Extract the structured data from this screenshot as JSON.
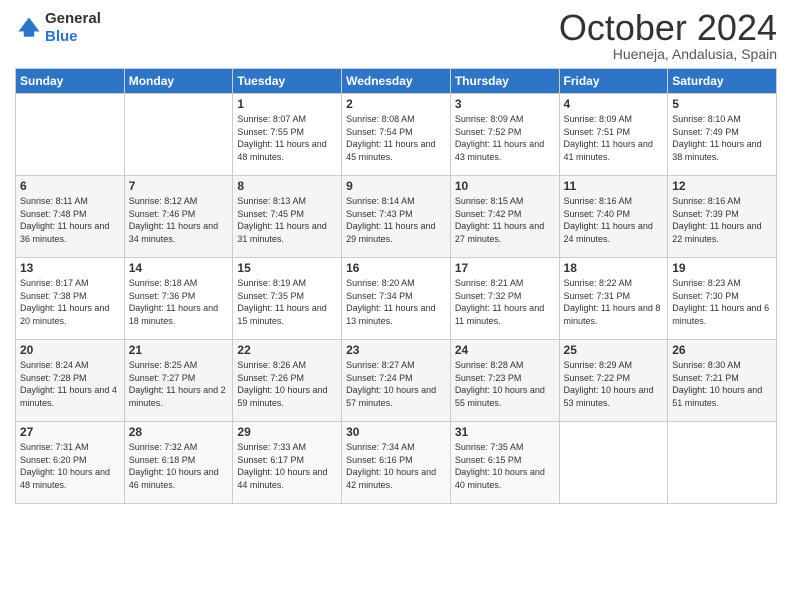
{
  "logo": {
    "general": "General",
    "blue": "Blue"
  },
  "header": {
    "month": "October 2024",
    "location": "Hueneja, Andalusia, Spain"
  },
  "days_of_week": [
    "Sunday",
    "Monday",
    "Tuesday",
    "Wednesday",
    "Thursday",
    "Friday",
    "Saturday"
  ],
  "weeks": [
    [
      {
        "day": "",
        "info": ""
      },
      {
        "day": "",
        "info": ""
      },
      {
        "day": "1",
        "info": "Sunrise: 8:07 AM\nSunset: 7:55 PM\nDaylight: 11 hours and 48 minutes."
      },
      {
        "day": "2",
        "info": "Sunrise: 8:08 AM\nSunset: 7:54 PM\nDaylight: 11 hours and 45 minutes."
      },
      {
        "day": "3",
        "info": "Sunrise: 8:09 AM\nSunset: 7:52 PM\nDaylight: 11 hours and 43 minutes."
      },
      {
        "day": "4",
        "info": "Sunrise: 8:09 AM\nSunset: 7:51 PM\nDaylight: 11 hours and 41 minutes."
      },
      {
        "day": "5",
        "info": "Sunrise: 8:10 AM\nSunset: 7:49 PM\nDaylight: 11 hours and 38 minutes."
      }
    ],
    [
      {
        "day": "6",
        "info": "Sunrise: 8:11 AM\nSunset: 7:48 PM\nDaylight: 11 hours and 36 minutes."
      },
      {
        "day": "7",
        "info": "Sunrise: 8:12 AM\nSunset: 7:46 PM\nDaylight: 11 hours and 34 minutes."
      },
      {
        "day": "8",
        "info": "Sunrise: 8:13 AM\nSunset: 7:45 PM\nDaylight: 11 hours and 31 minutes."
      },
      {
        "day": "9",
        "info": "Sunrise: 8:14 AM\nSunset: 7:43 PM\nDaylight: 11 hours and 29 minutes."
      },
      {
        "day": "10",
        "info": "Sunrise: 8:15 AM\nSunset: 7:42 PM\nDaylight: 11 hours and 27 minutes."
      },
      {
        "day": "11",
        "info": "Sunrise: 8:16 AM\nSunset: 7:40 PM\nDaylight: 11 hours and 24 minutes."
      },
      {
        "day": "12",
        "info": "Sunrise: 8:16 AM\nSunset: 7:39 PM\nDaylight: 11 hours and 22 minutes."
      }
    ],
    [
      {
        "day": "13",
        "info": "Sunrise: 8:17 AM\nSunset: 7:38 PM\nDaylight: 11 hours and 20 minutes."
      },
      {
        "day": "14",
        "info": "Sunrise: 8:18 AM\nSunset: 7:36 PM\nDaylight: 11 hours and 18 minutes."
      },
      {
        "day": "15",
        "info": "Sunrise: 8:19 AM\nSunset: 7:35 PM\nDaylight: 11 hours and 15 minutes."
      },
      {
        "day": "16",
        "info": "Sunrise: 8:20 AM\nSunset: 7:34 PM\nDaylight: 11 hours and 13 minutes."
      },
      {
        "day": "17",
        "info": "Sunrise: 8:21 AM\nSunset: 7:32 PM\nDaylight: 11 hours and 11 minutes."
      },
      {
        "day": "18",
        "info": "Sunrise: 8:22 AM\nSunset: 7:31 PM\nDaylight: 11 hours and 8 minutes."
      },
      {
        "day": "19",
        "info": "Sunrise: 8:23 AM\nSunset: 7:30 PM\nDaylight: 11 hours and 6 minutes."
      }
    ],
    [
      {
        "day": "20",
        "info": "Sunrise: 8:24 AM\nSunset: 7:28 PM\nDaylight: 11 hours and 4 minutes."
      },
      {
        "day": "21",
        "info": "Sunrise: 8:25 AM\nSunset: 7:27 PM\nDaylight: 11 hours and 2 minutes."
      },
      {
        "day": "22",
        "info": "Sunrise: 8:26 AM\nSunset: 7:26 PM\nDaylight: 10 hours and 59 minutes."
      },
      {
        "day": "23",
        "info": "Sunrise: 8:27 AM\nSunset: 7:24 PM\nDaylight: 10 hours and 57 minutes."
      },
      {
        "day": "24",
        "info": "Sunrise: 8:28 AM\nSunset: 7:23 PM\nDaylight: 10 hours and 55 minutes."
      },
      {
        "day": "25",
        "info": "Sunrise: 8:29 AM\nSunset: 7:22 PM\nDaylight: 10 hours and 53 minutes."
      },
      {
        "day": "26",
        "info": "Sunrise: 8:30 AM\nSunset: 7:21 PM\nDaylight: 10 hours and 51 minutes."
      }
    ],
    [
      {
        "day": "27",
        "info": "Sunrise: 7:31 AM\nSunset: 6:20 PM\nDaylight: 10 hours and 48 minutes."
      },
      {
        "day": "28",
        "info": "Sunrise: 7:32 AM\nSunset: 6:18 PM\nDaylight: 10 hours and 46 minutes."
      },
      {
        "day": "29",
        "info": "Sunrise: 7:33 AM\nSunset: 6:17 PM\nDaylight: 10 hours and 44 minutes."
      },
      {
        "day": "30",
        "info": "Sunrise: 7:34 AM\nSunset: 6:16 PM\nDaylight: 10 hours and 42 minutes."
      },
      {
        "day": "31",
        "info": "Sunrise: 7:35 AM\nSunset: 6:15 PM\nDaylight: 10 hours and 40 minutes."
      },
      {
        "day": "",
        "info": ""
      },
      {
        "day": "",
        "info": ""
      }
    ]
  ]
}
